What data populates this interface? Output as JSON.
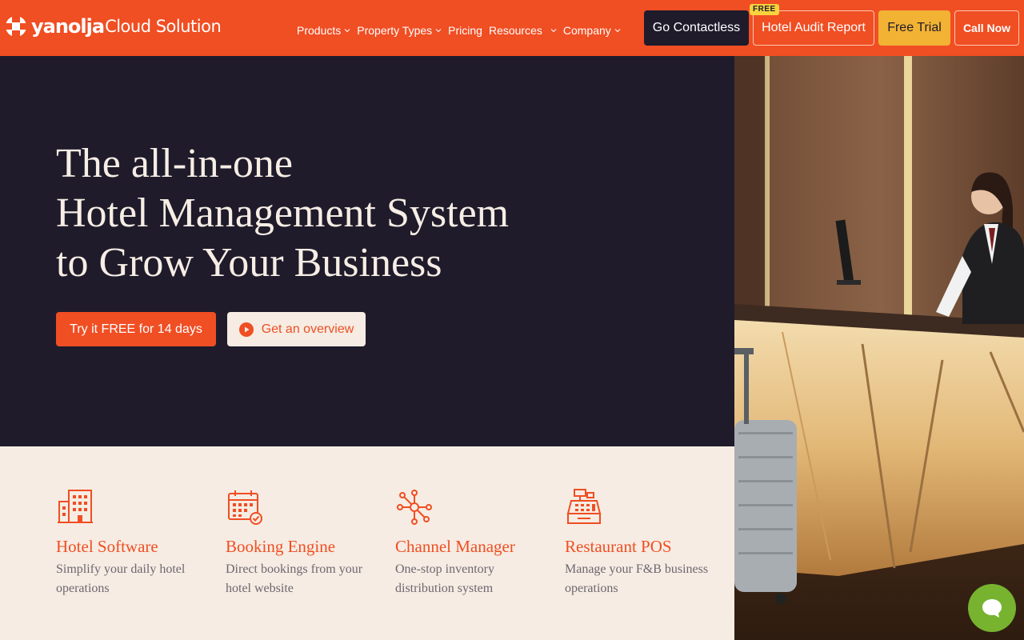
{
  "brand": {
    "name_part1": "yanolja",
    "name_part2": "Cloud Solution",
    "primary_color": "#f04e23",
    "dark_color": "#1f1b2b",
    "cream_color": "#f6ece3",
    "accent_yellow": "#f2b233"
  },
  "nav": {
    "items": [
      {
        "label": "Products",
        "has_dropdown": true
      },
      {
        "label": "Property Types",
        "has_dropdown": true
      },
      {
        "label": "Pricing",
        "has_dropdown": false
      },
      {
        "label": "Resources",
        "has_dropdown": true
      },
      {
        "label": "Company",
        "has_dropdown": true
      }
    ]
  },
  "header_buttons": {
    "contactless": "Go Contactless",
    "audit": "Hotel Audit Report",
    "audit_badge": "FREE",
    "trial": "Free Trial",
    "call": "Call Now"
  },
  "hero": {
    "title_lines": [
      "The all-in-one",
      "Hotel Management System",
      "to Grow Your Business"
    ],
    "cta_primary": "Try it FREE for 14 days",
    "cta_secondary": "Get an overview"
  },
  "products": [
    {
      "icon": "building-icon",
      "title": "Hotel Software",
      "desc": "Simplify your daily hotel operations"
    },
    {
      "icon": "calendar-check-icon",
      "title": "Booking Engine",
      "desc": "Direct bookings from your hotel website"
    },
    {
      "icon": "network-hub-icon",
      "title": "Channel Manager",
      "desc": "One-stop inventory distribution system"
    },
    {
      "icon": "cash-register-icon",
      "title": "Restaurant POS",
      "desc": "Manage your F&B business operations"
    }
  ],
  "chat": {
    "icon": "chat-bubble-icon",
    "color": "#77b32f"
  }
}
